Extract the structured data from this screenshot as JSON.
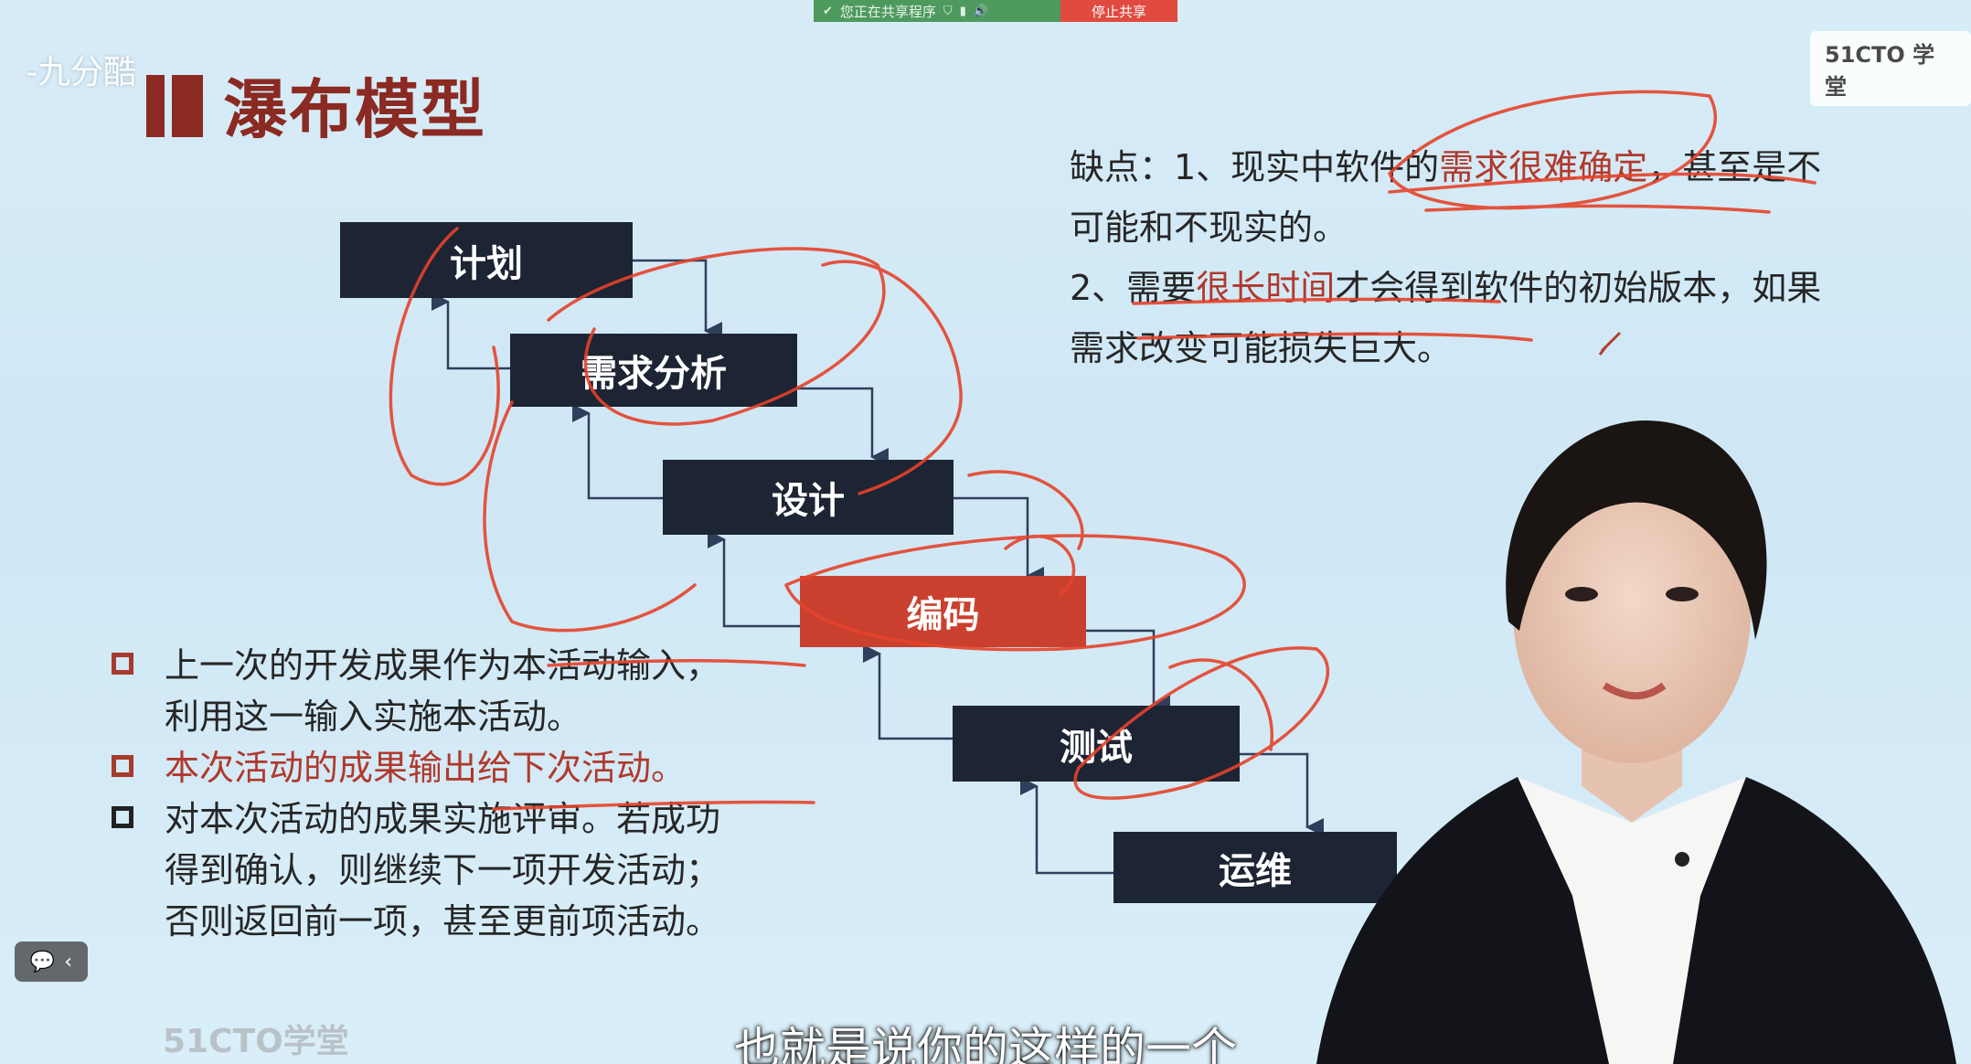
{
  "share_bar": {
    "status_text": "您正在共享程序",
    "stop_label": "停止共享"
  },
  "overlay": {
    "channel_title": "-九分酷"
  },
  "brand": {
    "top_badge": "51CTO 学堂",
    "footer": "51CTO学堂"
  },
  "slide": {
    "title": "瀑布模型",
    "flow_steps": [
      "计划",
      "需求分析",
      "设计",
      "编码",
      "测试",
      "运维"
    ],
    "highlighted_step": "编码",
    "disadvantages": {
      "p1_prefix": "缺点：1、现实中软件的",
      "p1_red": "需求很难确定",
      "p1_suffix": "，甚至是不可能和不现实的。",
      "p2_prefix": "2、需要",
      "p2_red": "很长时间",
      "p2_suffix": "才会得到软件的初始版本，如果需求改变可能损失巨大。"
    },
    "bullets": [
      {
        "lines": [
          "上一次的开发成果作为本活动输入，",
          "利用这一输入实施本活动。"
        ],
        "color": "dark"
      },
      {
        "lines": [
          "本次活动的成果输出给下次活动。"
        ],
        "color": "red"
      },
      {
        "lines": [
          "对本次活动的成果实施评审。若成功",
          "得到确认，则继续下一项开发活动；",
          "否则返回前一项，甚至更前项活动。"
        ],
        "color": "dark"
      }
    ]
  },
  "subtitle": "也就是说你的这样的一个",
  "colors": {
    "title": "#8b2a22",
    "box_dark": "#1d2433",
    "box_highlight": "#c9412e",
    "annotation": "#e5432b"
  }
}
